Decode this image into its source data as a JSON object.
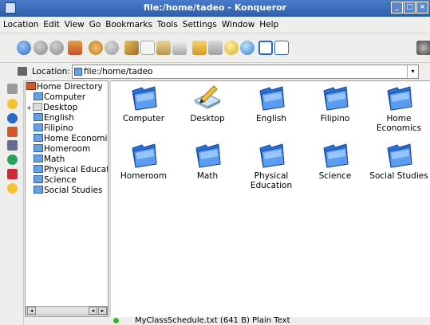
{
  "window": {
    "title": "file:/home/tadeo - Konqueror",
    "min": "_",
    "max": "□",
    "close": "×"
  },
  "menu": [
    "Location",
    "Edit",
    "View",
    "Go",
    "Bookmarks",
    "Tools",
    "Settings",
    "Window",
    "Help"
  ],
  "location": {
    "label": "Location:",
    "value": "file:/home/tadeo",
    "dropdown": "▾"
  },
  "tree": {
    "root": "Home Directory",
    "items": [
      "Computer",
      "Desktop",
      "English",
      "Filipino",
      "Home Economi",
      "Homeroom",
      "Math",
      "Physical Educat",
      "Science",
      "Social Studies"
    ],
    "expander": "+"
  },
  "files": [
    {
      "name": "Computer",
      "type": "folder"
    },
    {
      "name": "Desktop",
      "type": "desktop"
    },
    {
      "name": "English",
      "type": "folder"
    },
    {
      "name": "Filipino",
      "type": "folder"
    },
    {
      "name": "Home\nEconomics",
      "type": "folder"
    },
    {
      "name": "Homeroom",
      "type": "folder"
    },
    {
      "name": "Math",
      "type": "folder"
    },
    {
      "name": "Physical\nEducation",
      "type": "folder"
    },
    {
      "name": "Science",
      "type": "folder"
    },
    {
      "name": "Social Studies",
      "type": "folder"
    }
  ],
  "scroll": {
    "left": "◂",
    "right": "▸",
    "leftbox": "◂"
  },
  "status": {
    "text": "MyClassSchedule.txt (641 B)  Plain Text"
  }
}
